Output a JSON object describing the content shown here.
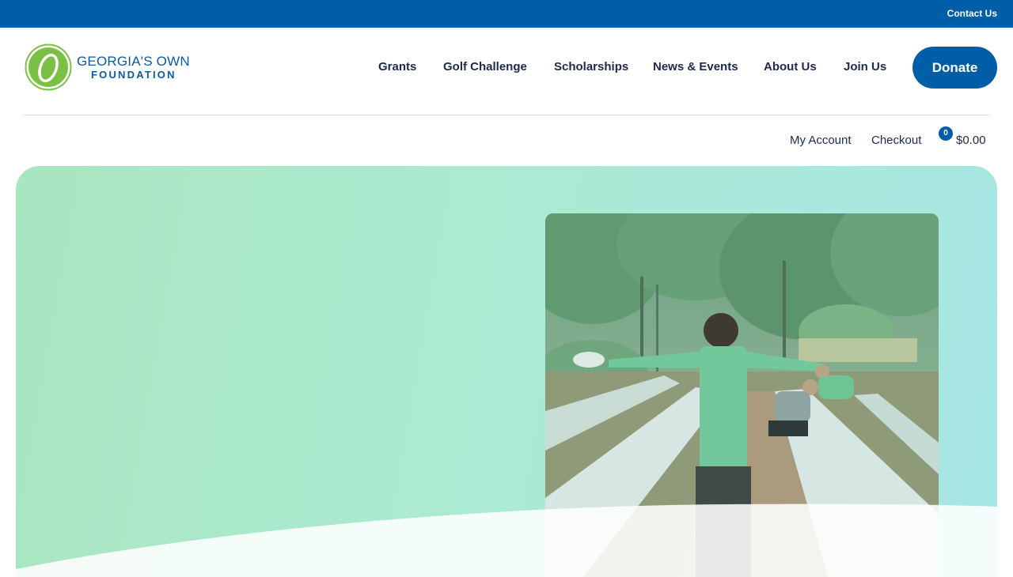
{
  "topbar": {
    "contact_label": "Contact Us"
  },
  "logo": {
    "line1": "GEORGIA'S OWN",
    "line2": "FOUNDATION"
  },
  "nav": {
    "items": [
      {
        "label": "Grants"
      },
      {
        "label": "Golf Challenge"
      },
      {
        "label": "Scholarships"
      },
      {
        "label": "News & Events"
      },
      {
        "label": "About Us"
      },
      {
        "label": "Join Us"
      }
    ],
    "donate_label": "Donate"
  },
  "utility": {
    "my_account": "My Account",
    "checkout": "Checkout",
    "cart_count": "0",
    "cart_total": "$0.00"
  },
  "colors": {
    "brand_blue": "#005ea8",
    "nav_text": "#1d2a4d",
    "logo_green": "#7ac143",
    "hero_green": "#a8e6c0",
    "hero_teal": "#a6e6e4"
  }
}
